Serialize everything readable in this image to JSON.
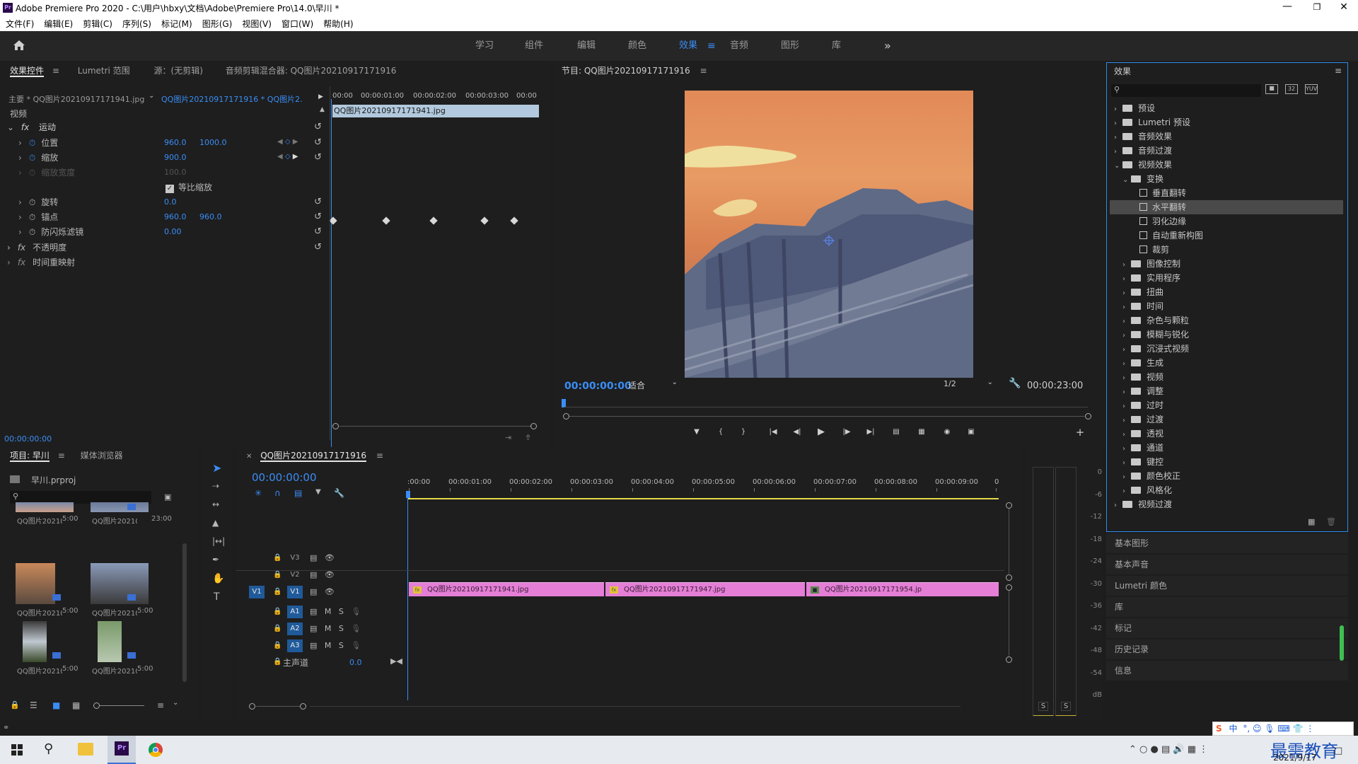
{
  "window": {
    "title": "Adobe Premiere Pro 2020 - C:\\用户\\hbxy\\文档\\Adobe\\Premiere Pro\\14.0\\早川 *",
    "logo": "Pr"
  },
  "menu": [
    "文件(F)",
    "编辑(E)",
    "剪辑(C)",
    "序列(S)",
    "标记(M)",
    "图形(G)",
    "视图(V)",
    "窗口(W)",
    "帮助(H)"
  ],
  "workspaces": [
    "学习",
    "组件",
    "编辑",
    "颜色",
    "效果",
    "音频",
    "图形",
    "库"
  ],
  "active_workspace": "效果",
  "effect_controls": {
    "tabs": [
      "效果控件",
      "Lumetri 范围",
      "源：(无剪辑)",
      "音频剪辑混合器: QQ图片20210917171916"
    ],
    "master_clip": "主要 * QQ图片20210917171941.jpg",
    "sequence_clip": "QQ图片20210917171916 * QQ图片2...",
    "ruler": [
      "00:00",
      "00:00:01:00",
      "00:00:02:00",
      "00:00:03:00",
      "00:00"
    ],
    "clip_bar": "QQ图片20210917171941.jpg",
    "section": "视频",
    "motion": "运动",
    "params": [
      {
        "name": "位置",
        "v1": "960.0",
        "v2": "1000.0"
      },
      {
        "name": "缩放",
        "v1": "900.0",
        "v2": ""
      },
      {
        "name": "缩放宽度",
        "v1": "100.0",
        "v2": ""
      },
      {
        "name": "等比缩放",
        "v1": "",
        "v2": ""
      },
      {
        "name": "旋转",
        "v1": "0.0",
        "v2": ""
      },
      {
        "name": "锚点",
        "v1": "960.0",
        "v2": "960.0"
      },
      {
        "name": "防闪烁滤镜",
        "v1": "0.00",
        "v2": ""
      }
    ],
    "opacity": "不透明度",
    "time_remap": "时间重映射",
    "timecode": "00:00:00:00"
  },
  "program": {
    "title": "节目: QQ图片20210917171916",
    "timecode": "00:00:00:00",
    "fit": "适合",
    "resolution": "1/2",
    "duration": "00:00:23:00"
  },
  "effects_panel": {
    "title": "效果",
    "tree": [
      {
        "label": "预设",
        "level": 0,
        "type": "bin"
      },
      {
        "label": "Lumetri 预设",
        "level": 0,
        "type": "bin"
      },
      {
        "label": "音频效果",
        "level": 0,
        "type": "folder"
      },
      {
        "label": "音频过渡",
        "level": 0,
        "type": "folder"
      },
      {
        "label": "视频效果",
        "level": 0,
        "type": "folder",
        "open": true
      },
      {
        "label": "变换",
        "level": 1,
        "type": "folder",
        "open": true
      },
      {
        "label": "垂直翻转",
        "level": 2,
        "type": "fx"
      },
      {
        "label": "水平翻转",
        "level": 2,
        "type": "fx",
        "selected": true
      },
      {
        "label": "羽化边缘",
        "level": 2,
        "type": "fx"
      },
      {
        "label": "自动重新构图",
        "level": 2,
        "type": "fx"
      },
      {
        "label": "裁剪",
        "level": 2,
        "type": "fx"
      },
      {
        "label": "图像控制",
        "level": 1,
        "type": "folder"
      },
      {
        "label": "实用程序",
        "level": 1,
        "type": "folder"
      },
      {
        "label": "扭曲",
        "level": 1,
        "type": "folder"
      },
      {
        "label": "时间",
        "level": 1,
        "type": "folder"
      },
      {
        "label": "杂色与颗粒",
        "level": 1,
        "type": "folder"
      },
      {
        "label": "模糊与锐化",
        "level": 1,
        "type": "folder"
      },
      {
        "label": "沉浸式视频",
        "level": 1,
        "type": "folder"
      },
      {
        "label": "生成",
        "level": 1,
        "type": "folder"
      },
      {
        "label": "视频",
        "level": 1,
        "type": "folder"
      },
      {
        "label": "调整",
        "level": 1,
        "type": "folder"
      },
      {
        "label": "过时",
        "level": 1,
        "type": "folder"
      },
      {
        "label": "过渡",
        "level": 1,
        "type": "folder"
      },
      {
        "label": "透视",
        "level": 1,
        "type": "folder"
      },
      {
        "label": "通道",
        "level": 1,
        "type": "folder"
      },
      {
        "label": "键控",
        "level": 1,
        "type": "folder"
      },
      {
        "label": "颜色校正",
        "level": 1,
        "type": "folder"
      },
      {
        "label": "风格化",
        "level": 1,
        "type": "folder"
      },
      {
        "label": "视频过渡",
        "level": 0,
        "type": "folder"
      }
    ],
    "collapsed_panels": [
      "基本图形",
      "基本声音",
      "Lumetri 颜色",
      "库",
      "标记",
      "历史记录",
      "信息"
    ]
  },
  "project": {
    "tabs": [
      "项目: 早川",
      "媒体浏览器"
    ],
    "file": "早川.prproj",
    "items": [
      {
        "name": "QQ图片2021091...",
        "dur": "5:00"
      },
      {
        "name": "QQ图片202109...",
        "dur": "23:00"
      },
      {
        "name": "QQ图片202109...",
        "dur": "5:00"
      },
      {
        "name": "QQ图片202109...",
        "dur": "5:00"
      },
      {
        "name": "QQ图片202109...",
        "dur": "5:00"
      },
      {
        "name": "QQ图片202109...",
        "dur": "5:00"
      }
    ]
  },
  "timeline": {
    "title": "QQ图片20210917171916",
    "timecode": "00:00:00:00",
    "ruler": [
      ":00:00",
      "00:00:01:00",
      "00:00:02:00",
      "00:00:03:00",
      "00:00:04:00",
      "00:00:05:00",
      "00:00:06:00",
      "00:00:07:00",
      "00:00:08:00",
      "00:00:09:00",
      "0"
    ],
    "tracks": [
      "V3",
      "V2",
      "V1",
      "A1",
      "A2",
      "A3"
    ],
    "source_patch": [
      "V1",
      "A1"
    ],
    "master": "主声道",
    "master_val": "0.0",
    "clips": [
      {
        "name": "QQ图片20210917171941.jpg"
      },
      {
        "name": "QQ图片20210917171947.jpg"
      },
      {
        "name": "QQ图片20210917171954.jp"
      }
    ]
  },
  "audio_meter": {
    "ticks": [
      "0",
      "-6",
      "-12",
      "-18",
      "-24",
      "-30",
      "-36",
      "-42",
      "-48",
      "-54",
      "dB"
    ],
    "solo": [
      "S",
      "S"
    ]
  },
  "taskbar": {
    "clock_date": "2021/9/17",
    "watermark": "最需教育",
    "ime": "中"
  }
}
